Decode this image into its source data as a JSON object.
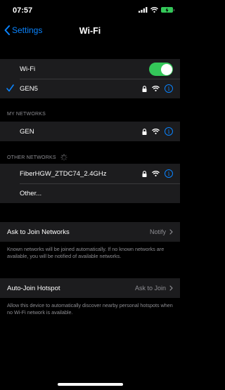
{
  "status_bar": {
    "time": "07:57",
    "battery_level": ""
  },
  "nav": {
    "back_label": "Settings",
    "title": "Wi-Fi"
  },
  "wifi_toggle": {
    "label": "Wi-Fi",
    "on": true
  },
  "connected_network": {
    "name": "GEN5",
    "secured": true
  },
  "my_networks": {
    "header": "MY NETWORKS",
    "items": [
      {
        "name": "GEN",
        "secured": true
      }
    ]
  },
  "other_networks": {
    "header": "OTHER NETWORKS",
    "items": [
      {
        "name": "FiberHGW_ZTDC74_2.4GHz",
        "secured": true
      }
    ],
    "other_label": "Other..."
  },
  "ask_to_join": {
    "label": "Ask to Join Networks",
    "value": "Notify",
    "footer": "Known networks will be joined automatically. If no known networks are available, you will be notified of available networks."
  },
  "auto_join_hotspot": {
    "label": "Auto-Join Hotspot",
    "value": "Ask to Join",
    "footer": "Allow this device to automatically discover nearby personal hotspots when no Wi-Fi network is available."
  },
  "colors": {
    "accent": "#0a84ff",
    "toggle_on": "#34c759",
    "cell_bg": "#1c1c1e",
    "secondary_text": "#8e8e93"
  }
}
